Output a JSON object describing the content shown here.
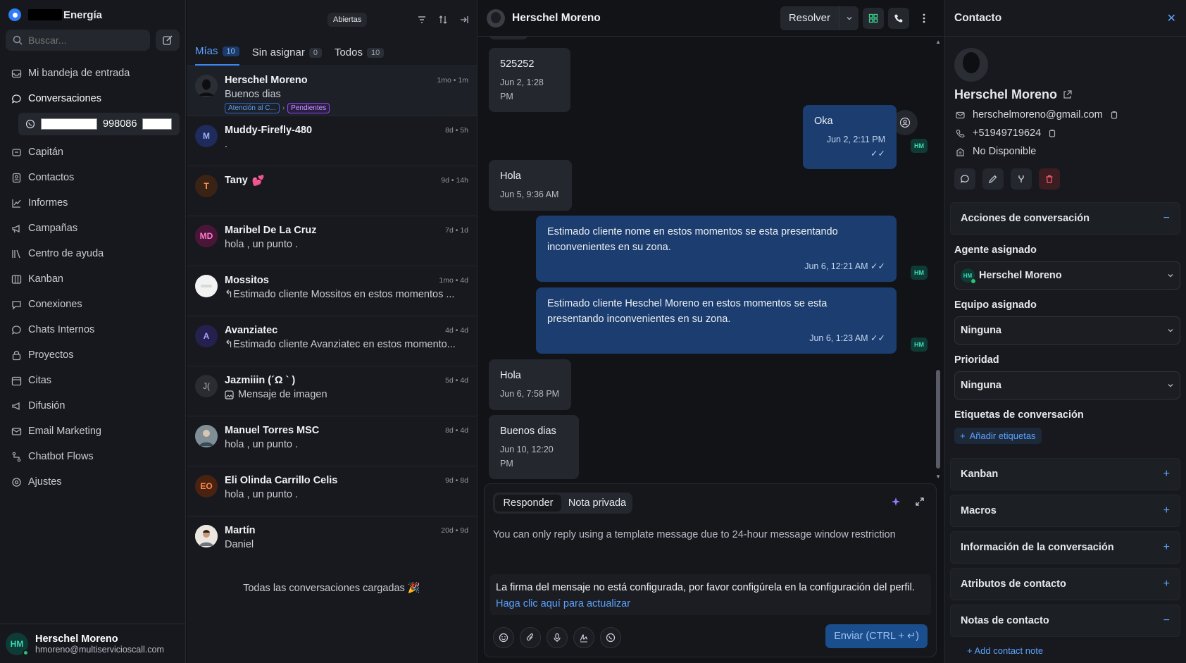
{
  "sidebar": {
    "brand": "Energía",
    "search_placeholder": "Buscar...",
    "items": [
      {
        "label": "Mi bandeja de entrada"
      },
      {
        "label": "Conversaciones"
      },
      {
        "label": "Capitán"
      },
      {
        "label": "Contactos"
      },
      {
        "label": "Informes"
      },
      {
        "label": "Campañas"
      },
      {
        "label": "Centro de ayuda"
      },
      {
        "label": "Kanban"
      },
      {
        "label": "Conexiones"
      },
      {
        "label": "Chats Internos"
      },
      {
        "label": "Proyectos"
      },
      {
        "label": "Citas"
      },
      {
        "label": "Difusión"
      },
      {
        "label": "Email Marketing"
      },
      {
        "label": "Chatbot Flows"
      },
      {
        "label": "Ajustes"
      }
    ],
    "inbox_number": "998086",
    "user": {
      "initials": "HM",
      "name": "Herschel Moreno",
      "email": "hmoreno@multiservicioscall.com"
    }
  },
  "list": {
    "status_filter": "Abiertas",
    "tabs": [
      {
        "label": "Mías",
        "count": "10"
      },
      {
        "label": "Sin asignar",
        "count": "0"
      },
      {
        "label": "Todos",
        "count": "10"
      }
    ],
    "conversations": [
      {
        "name": "Herschel Moreno",
        "message": "Buenos dias",
        "time": "1mo • 1m",
        "initials": "",
        "tags": [
          "Atención al C...",
          "Pendientes"
        ]
      },
      {
        "name": "Muddy-Firefly-480",
        "message": ".",
        "time": "8d • 5h",
        "initials": "M"
      },
      {
        "name": "Tany",
        "emoji": "💕",
        "message": "",
        "time": "9d • 14h",
        "initials": "T"
      },
      {
        "name": "Maribel De La Cruz",
        "message": "hola , un punto .",
        "time": "7d • 1d",
        "initials": "MD"
      },
      {
        "name": "Mossitos",
        "message": "↰Estimado cliente Mossitos en estos momentos ...",
        "time": "1mo • 4d",
        "initials": ""
      },
      {
        "name": "Avanziatec",
        "message": "↰Estimado cliente Avanziatec en estos momento...",
        "time": "4d • 4d",
        "initials": "A"
      },
      {
        "name": "Jazmiiin (´Ω ` )",
        "message": "Mensaje de imagen",
        "time": "5d • 4d",
        "initials": "J("
      },
      {
        "name": "Manuel Torres MSC",
        "message": "hola , un punto .",
        "time": "8d • 4d",
        "initials": ""
      },
      {
        "name": "Eli Olinda Carrillo Celis",
        "message": "hola , un punto .",
        "time": "9d • 8d",
        "initials": "EO"
      },
      {
        "name": "Martín",
        "message": "Daniel",
        "time": "20d • 9d",
        "initials": ""
      }
    ],
    "end_text": "Todas las conversaciones cargadas 🎉"
  },
  "chat": {
    "contact_name": "Herschel Moreno",
    "resolve_label": "Resolver",
    "messages": [
      {
        "dir": "in",
        "text": "525252",
        "time": "Jun 2, 1:28 PM"
      },
      {
        "dir": "out",
        "text": "Oka",
        "time": "Jun 2, 2:11 PM ✓✓",
        "agent": "HM"
      },
      {
        "dir": "in",
        "text": "Hola",
        "time": "Jun 5, 9:36 AM"
      },
      {
        "dir": "out",
        "text": "Estimado cliente nome en estos momentos se esta presentando inconvenientes en su zona.",
        "time": "Jun 6, 12:21 AM ✓✓",
        "agent": "HM"
      },
      {
        "dir": "out",
        "text": "Estimado cliente Heschel Moreno en estos momentos se esta presentando inconvenientes en su zona.",
        "time": "Jun 6, 1:23 AM ✓✓",
        "agent": "HM"
      },
      {
        "dir": "in",
        "text": "Hola",
        "time": "Jun 6, 7:58 PM"
      },
      {
        "dir": "in",
        "text": "Buenos dias",
        "time": "Jun 10, 12:20 PM"
      }
    ],
    "composer": {
      "tab_reply": "Responder",
      "tab_private": "Nota privada",
      "warning": "You can only reply using a template message due to 24-hour message window restriction",
      "signature_text": "La firma del mensaje no está configurada, por favor configúrela en la configuración del perfil.",
      "signature_link": "Haga clic aquí para actualizar",
      "send_label": "Enviar (CTRL + ↵)"
    }
  },
  "contact": {
    "title": "Contacto",
    "name": "Herschel Moreno",
    "email": "herschelmoreno@gmail.com",
    "phone": "+51949719624",
    "company": "No Disponible",
    "actions_title": "Acciones de conversación",
    "assigned_agent_label": "Agente asignado",
    "assigned_agent": "Herschel Moreno",
    "assigned_agent_initials": "HM",
    "team_label": "Equipo asignado",
    "team": "Ninguna",
    "priority_label": "Prioridad",
    "priority": "Ninguna",
    "labels_title": "Etiquetas de conversación",
    "add_labels": "Añadir etiquetas",
    "sections": [
      "Kanban",
      "Macros",
      "Información de la conversación",
      "Atributos de contacto",
      "Notas de contacto"
    ],
    "add_note": "Add contact note"
  },
  "colors": {
    "accent": "#3a86f7",
    "outgoing_bubble": "#1b3d70",
    "danger": "#ff5d6c",
    "online": "#29c46b"
  }
}
